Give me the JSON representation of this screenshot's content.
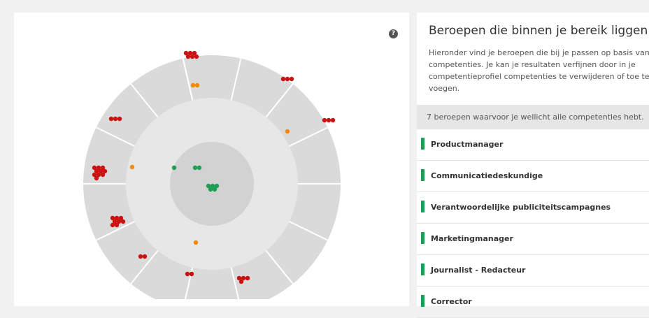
{
  "help": {
    "icon": "question-circle-icon",
    "glyph": "?"
  },
  "panel": {
    "title": "Beroepen die binnen je bereik liggen",
    "description": "Hieronder vind je beroepen die bij je passen op basis van competenties. Je kan je resultaten verfijnen door in je competentieprofiel competenties te verwijderen of toe te voegen.",
    "summary": "7 beroepen waarvoor je wellicht alle competenties hebt.",
    "jobs": [
      {
        "label": "Productmanager"
      },
      {
        "label": "Communicatiedeskundige"
      },
      {
        "label": "Verantwoordelijke publiciteitscampagnes"
      },
      {
        "label": "Marketingmanager"
      },
      {
        "label": "Journalist - Redacteur"
      },
      {
        "label": "Corrector"
      }
    ]
  },
  "colors": {
    "match_full": "#1f9d55",
    "match_partial": "#f08a0c",
    "match_none": "#cc1111",
    "ring_outer": "#dadada",
    "ring_middle": "#e7e7e7",
    "ring_inner": "#d2d2d2"
  }
}
